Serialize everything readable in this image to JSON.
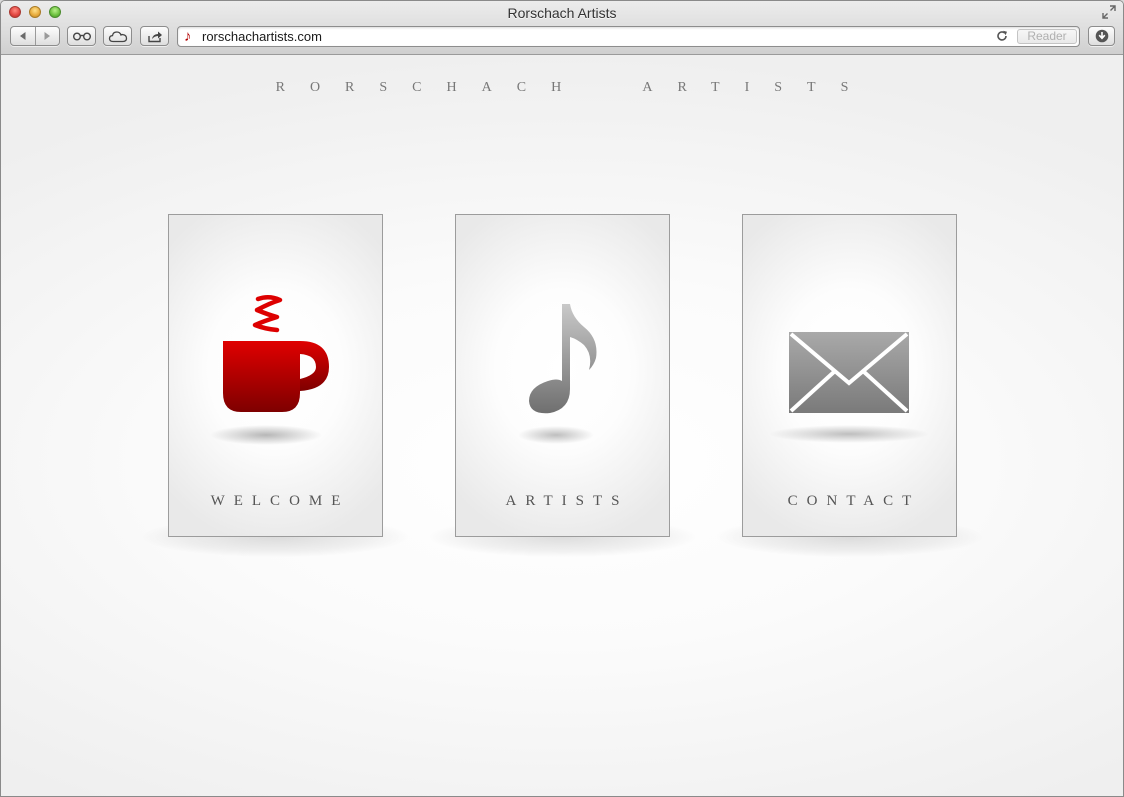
{
  "window": {
    "title": "Rorschach Artists"
  },
  "toolbar": {
    "back_icon": "back-arrow-icon",
    "forward_icon": "forward-arrow-icon",
    "reading_list_icon": "reading-list-glasses-icon",
    "icloud_icon": "icloud-cloud-icon",
    "share_icon": "share-arrow-icon",
    "download_icon": "download-arrow-icon"
  },
  "address_bar": {
    "favicon": "♪",
    "url": "rorschachartists.com",
    "reload_icon": "reload-icon",
    "reader_label": "Reader"
  },
  "page": {
    "site_title": "RORSCHACH  ARTISTS",
    "cards": [
      {
        "label": "WELCOME",
        "icon": "coffee-cup-icon",
        "icon_color": "#c00000"
      },
      {
        "label": "ARTISTS",
        "icon": "music-note-icon",
        "icon_color": "#808080"
      },
      {
        "label": "CONTACT",
        "icon": "envelope-icon",
        "icon_color": "#8a8a8a"
      }
    ]
  }
}
